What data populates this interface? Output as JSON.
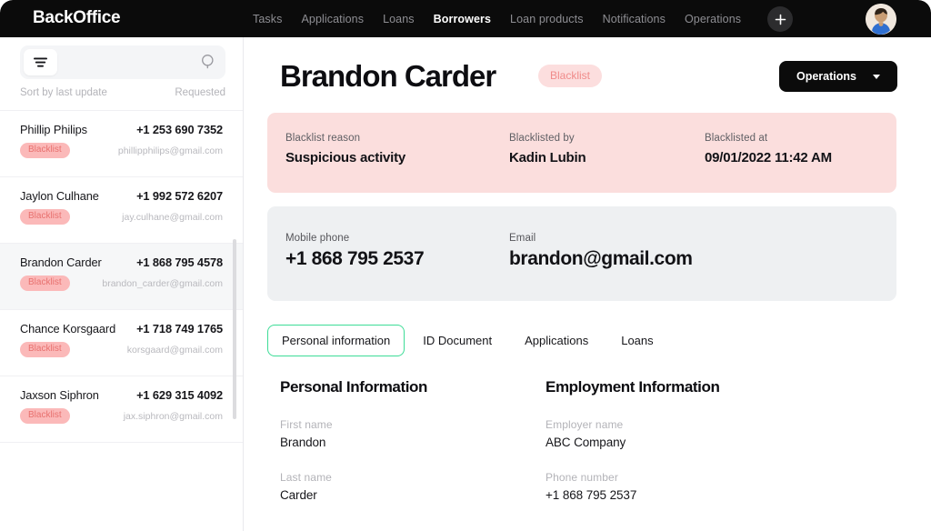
{
  "brand": "BackOffice",
  "nav": {
    "items": [
      {
        "label": "Tasks",
        "active": false
      },
      {
        "label": "Applications",
        "active": false
      },
      {
        "label": "Loans",
        "active": false
      },
      {
        "label": "Borrowers",
        "active": true
      },
      {
        "label": "Loan products",
        "active": false
      },
      {
        "label": "Notifications",
        "active": false
      },
      {
        "label": "Operations",
        "active": false
      }
    ],
    "add_icon": "plus-icon",
    "avatar_icon": "user-avatar"
  },
  "sidebar": {
    "filter_icon": "filter-icon",
    "search_icon": "search-icon",
    "search_placeholder": "",
    "search_value": "",
    "sort_label": "Sort by last update",
    "sort_value": "Requested",
    "items": [
      {
        "name": "Phillip Philips",
        "phone": "+1 253 690 7352",
        "badge": "Blacklist",
        "email": "phillipphilips@gmail.com",
        "selected": false
      },
      {
        "name": "Jaylon Culhane",
        "phone": "+1 992 572 6207",
        "badge": "Blacklist",
        "email": "jay.culhane@gmail.com",
        "selected": false
      },
      {
        "name": "Brandon Carder",
        "phone": "+1 868 795 4578",
        "badge": "Blacklist",
        "email": "brandon_carder@gmail.com",
        "selected": true
      },
      {
        "name": "Chance Korsgaard",
        "phone": "+1 718 749 1765",
        "badge": "Blacklist",
        "email": "korsgaard@gmail.com",
        "selected": false
      },
      {
        "name": "Jaxson Siphron",
        "phone": "+1 629 315 4092",
        "badge": "Blacklist",
        "email": "jax.siphron@gmail.com",
        "selected": false
      }
    ]
  },
  "main": {
    "title": "Brandon Carder",
    "status_badge": "Blacklist",
    "operations_button": "Operations",
    "blacklist_card": {
      "reason_label": "Blacklist reason",
      "reason_value": "Suspicious activity",
      "by_label": "Blacklisted by",
      "by_value": "Kadin Lubin",
      "at_label": "Blacklisted at",
      "at_value": "09/01/2022 11:42 AM"
    },
    "contact_card": {
      "phone_label": "Mobile phone",
      "phone_value": "+1 868 795 2537",
      "email_label": "Email",
      "email_value": "brandon@gmail.com"
    },
    "tabs": [
      {
        "label": "Personal information",
        "active": true
      },
      {
        "label": "ID Document",
        "active": false
      },
      {
        "label": "Applications",
        "active": false
      },
      {
        "label": "Loans",
        "active": false
      }
    ],
    "personal": {
      "title": "Personal Information",
      "first_name_label": "First name",
      "first_name_value": "Brandon",
      "last_name_label": "Last name",
      "last_name_value": "Carder"
    },
    "employment": {
      "title": "Employment Information",
      "employer_label": "Employer name",
      "employer_value": "ABC Company",
      "phone_label": "Phone number",
      "phone_value": "+1 868 795 2537"
    }
  },
  "colors": {
    "nav_bg": "#0b0b0b",
    "accent_green": "#3ddc97",
    "blacklist_card_bg": "#fbdedd",
    "contact_card_bg": "#eef0f2",
    "badge_pink": "#fbb9b9",
    "badge_text": "#e8716f"
  }
}
